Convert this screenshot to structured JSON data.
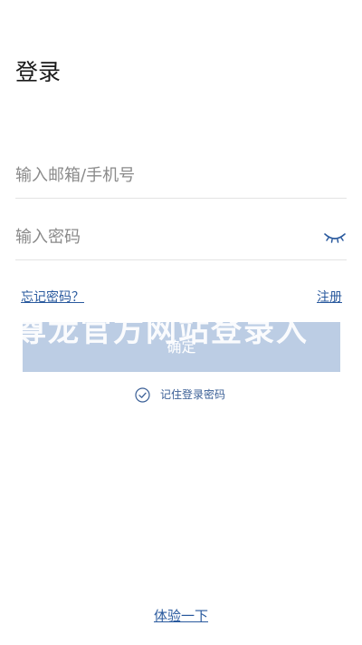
{
  "page": {
    "title": "登录"
  },
  "form": {
    "account_placeholder": "输入邮箱/手机号",
    "account_value": "",
    "password_placeholder": "输入密码",
    "password_value": "",
    "password_toggle_icon": "eye-closed-icon"
  },
  "links": {
    "forgot_password": "忘记密码？",
    "register": "注册"
  },
  "confirm": {
    "label": "确定",
    "overlay_text": "尊龙官方网站登录入",
    "background_color": "#bccde4"
  },
  "remember": {
    "label": "记住登录密码",
    "checked": true,
    "icon": "check-circle-icon"
  },
  "footer": {
    "trial_link": "体验一下"
  },
  "colors": {
    "accent": "#2a5a9e",
    "divider": "#e3e3e3"
  }
}
